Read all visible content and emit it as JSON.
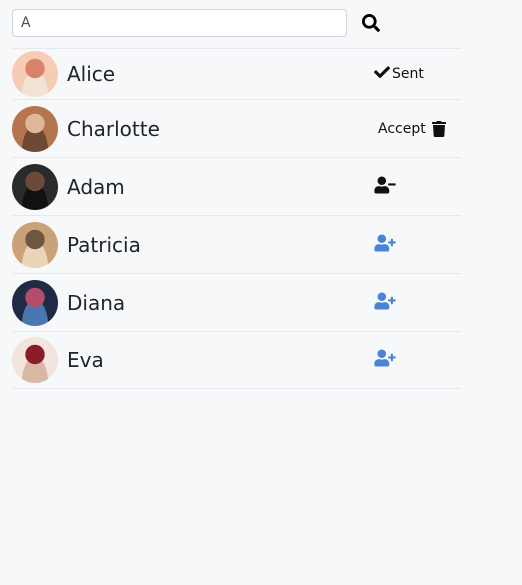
{
  "search": {
    "value": "A",
    "placeholder": ""
  },
  "contacts": [
    {
      "name": "Alice",
      "action": "sent",
      "action_label": "Sent",
      "action_icon": "check-icon",
      "avatar_colors": [
        "#f6cdb4",
        "#d9826a",
        "#f3e2d6"
      ]
    },
    {
      "name": "Charlotte",
      "action": "accept",
      "action_label": "Accept",
      "action_icon": "trash-icon",
      "avatar_colors": [
        "#b5754d",
        "#e0b899",
        "#6d4a33"
      ]
    },
    {
      "name": "Adam",
      "action": "remove-friend",
      "action_label": "",
      "action_icon": "user-minus-icon",
      "avatar_colors": [
        "#2a2a2a",
        "#6b4a3a",
        "#111111"
      ]
    },
    {
      "name": "Patricia",
      "action": "add-friend",
      "action_label": "",
      "action_icon": "user-plus-icon",
      "avatar_colors": [
        "#c9a27a",
        "#6e5640",
        "#e9d5b8"
      ]
    },
    {
      "name": "Diana",
      "action": "add-friend",
      "action_label": "",
      "action_icon": "user-plus-icon",
      "avatar_colors": [
        "#1f2a44",
        "#b54c6c",
        "#4b77b0"
      ]
    },
    {
      "name": "Eva",
      "action": "add-friend",
      "action_label": "",
      "action_icon": "user-plus-icon",
      "avatar_colors": [
        "#f2e5dd",
        "#8c1c2a",
        "#d9b8a3"
      ]
    }
  ],
  "colors": {
    "add_icon": "#4a84d6",
    "dark_icon": "#111111",
    "divider": "#e6e8eb",
    "background": "#f7f8fa"
  }
}
